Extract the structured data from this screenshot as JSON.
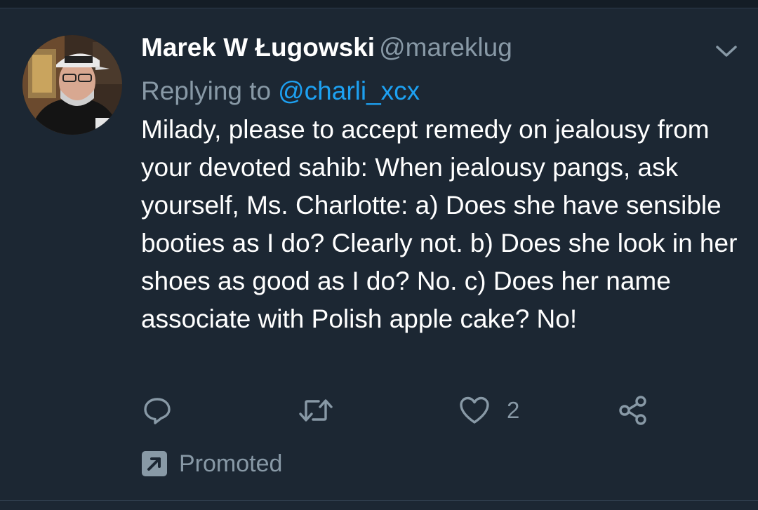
{
  "tweet": {
    "author": {
      "display_name": "Marek W Ługowski",
      "handle": "@mareklug",
      "avatar_icon": "profile-photo-avatar"
    },
    "reply": {
      "prefix": "Replying to",
      "handle": "@charli_xcx"
    },
    "text": "Milady, please to accept remedy on jealousy from your devoted sahib: When jealousy pangs, ask yourself, Ms. Charlotte: a) Does she have sensible booties as I do? Clearly not. b) Does she look in her shoes as good as I do? No. c) Does her name associate with Polish apple cake? No!",
    "actions": {
      "reply_icon": "speech-bubble-icon",
      "retweet_icon": "retweet-arrows-icon",
      "like_icon": "heart-icon",
      "like_count": "2",
      "share_icon": "share-icon"
    },
    "promoted": {
      "icon": "promoted-arrow-icon",
      "label": "Promoted"
    },
    "menu_icon": "chevron-down-icon"
  },
  "colors": {
    "background": "#1c2733",
    "secondary_text": "#8899a6",
    "link": "#1da1f2",
    "primary_text": "#ffffff"
  }
}
